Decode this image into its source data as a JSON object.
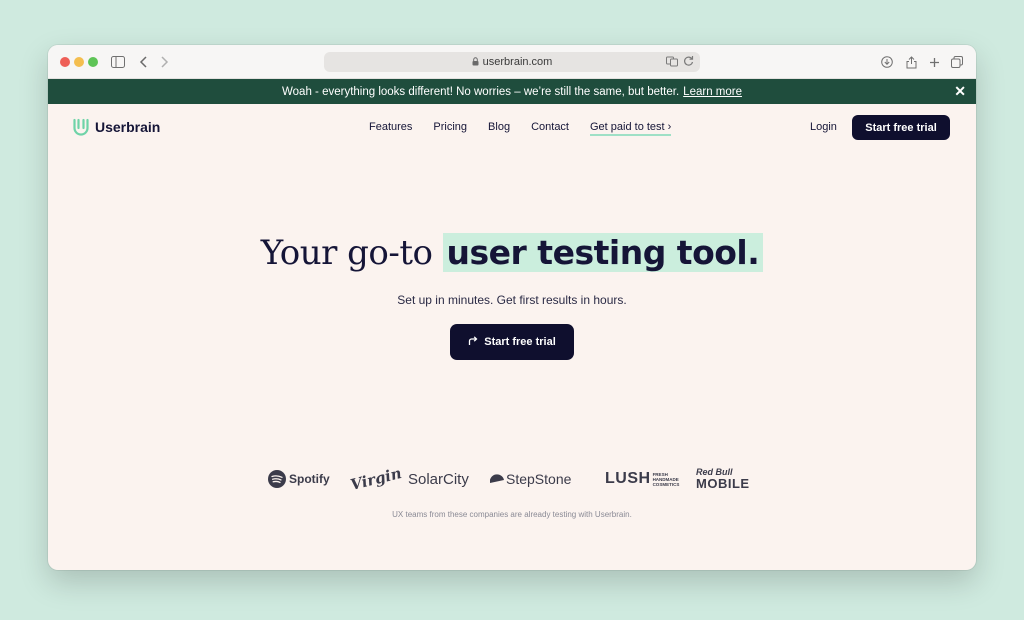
{
  "browser": {
    "url": "userbrain.com"
  },
  "banner": {
    "message": "Woah - everything looks different! No worries – we’re still the same, but better.",
    "link": "Learn more",
    "close": "✕"
  },
  "nav": {
    "logo": "Userbrain",
    "items": [
      "Features",
      "Pricing",
      "Blog",
      "Contact",
      "Get paid to test ›"
    ],
    "login": "Login",
    "cta": "Start free trial"
  },
  "hero": {
    "title_plain": "Your go-to",
    "title_highlight": "user testing tool.",
    "subtitle": "Set up in minutes. Get first results in hours.",
    "cta": "Start free trial"
  },
  "logos": {
    "brands": [
      "Spotify",
      "Virgin",
      "SolarCity",
      "StepStone",
      "LUSH",
      "Red Bull MOBILE"
    ],
    "lush_tag": [
      "FRESH",
      "HANDMADE",
      "COSMETICS"
    ],
    "redbull_top": "Red Bull",
    "redbull_bottom": "MOBILE",
    "caption": "UX teams from these companies are already testing with Userbrain."
  },
  "colors": {
    "banner": "#1f4d3d",
    "accent": "#cbeedd",
    "primary_button": "#0f0f2e",
    "page_bg": "#fbf3ef",
    "desktop_bg": "#cfeadf"
  }
}
